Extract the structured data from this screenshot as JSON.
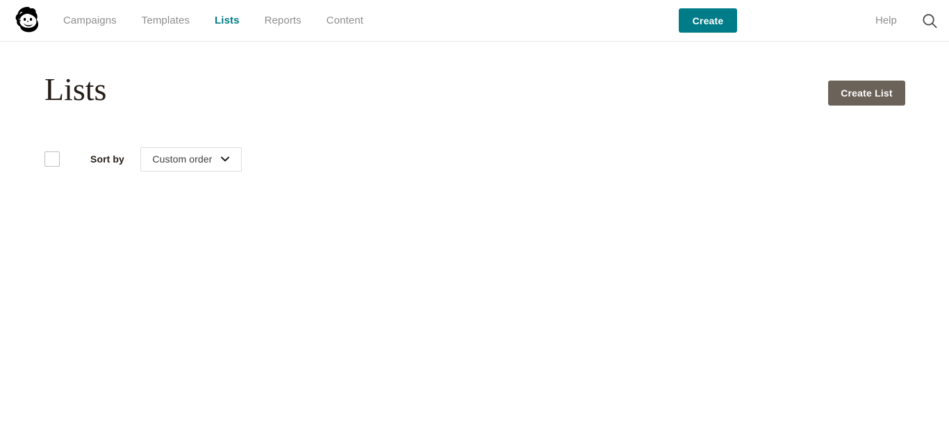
{
  "header": {
    "logo_alt": "Mailchimp Freddie logo",
    "nav": [
      {
        "label": "Campaigns",
        "active": false
      },
      {
        "label": "Templates",
        "active": false
      },
      {
        "label": "Lists",
        "active": true
      },
      {
        "label": "Reports",
        "active": false
      },
      {
        "label": "Content",
        "active": false
      }
    ],
    "create_button": "Create",
    "help_link": "Help",
    "search_icon": "search-icon",
    "accent_color": "#007c89"
  },
  "page": {
    "title": "Lists",
    "create_list_button": "Create List",
    "create_list_button_color": "#6b625a"
  },
  "sort_row": {
    "select_all_checked": false,
    "sort_by_label": "Sort by",
    "sort_value": "Custom order",
    "chevron_icon": "chevron-down-icon",
    "options": [
      "Custom order"
    ]
  },
  "content": {
    "lists": []
  }
}
